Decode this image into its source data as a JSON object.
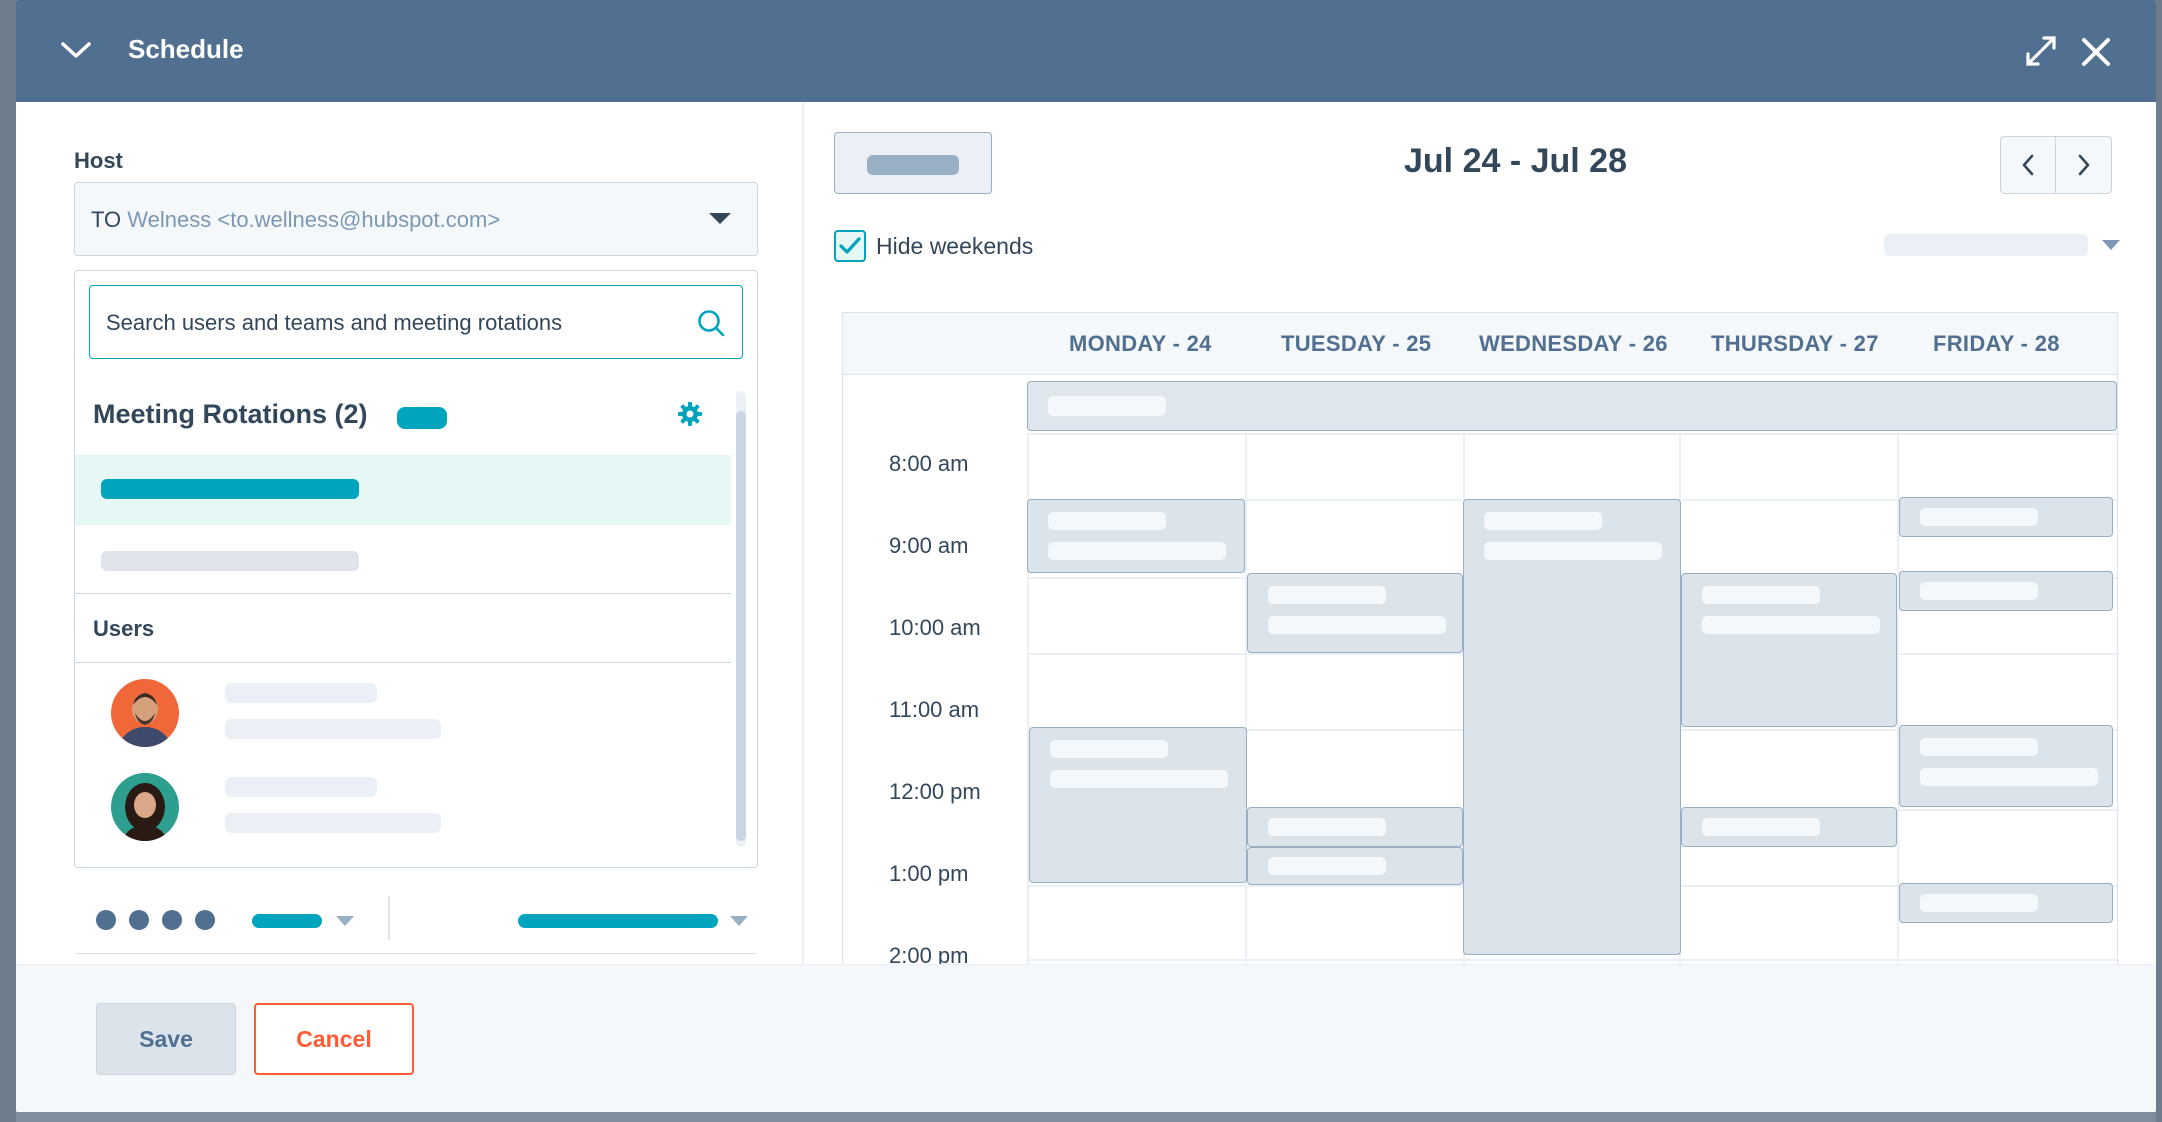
{
  "header": {
    "title": "Schedule",
    "color": "#516f90"
  },
  "host": {
    "label": "Host",
    "initials": "TO",
    "value": "Welness <to.wellness@hubspot.com>"
  },
  "search": {
    "placeholder": "Search users and teams and meeting rotations"
  },
  "rotations": {
    "title": "Meeting Rotations (2)"
  },
  "users": {
    "title": "Users"
  },
  "calendar": {
    "range": "Jul 24 - Jul 28",
    "hide_weekends_label": "Hide weekends",
    "hide_weekends_checked": true,
    "days": [
      "MONDAY - 24",
      "TUESDAY - 25",
      "WEDNESDAY - 26",
      "THURSDAY - 27",
      "FRIDAY - 28"
    ],
    "times": [
      "8:00 am",
      "9:00 am",
      "10:00 am",
      "11:00 am",
      "12:00 pm",
      "1:00 pm",
      "2:00 pm"
    ]
  },
  "footer": {
    "save_label": "Save",
    "cancel_label": "Cancel"
  },
  "colors": {
    "accent": "#00a4bd",
    "cancel": "#ff5c35",
    "text": "#33475b"
  }
}
